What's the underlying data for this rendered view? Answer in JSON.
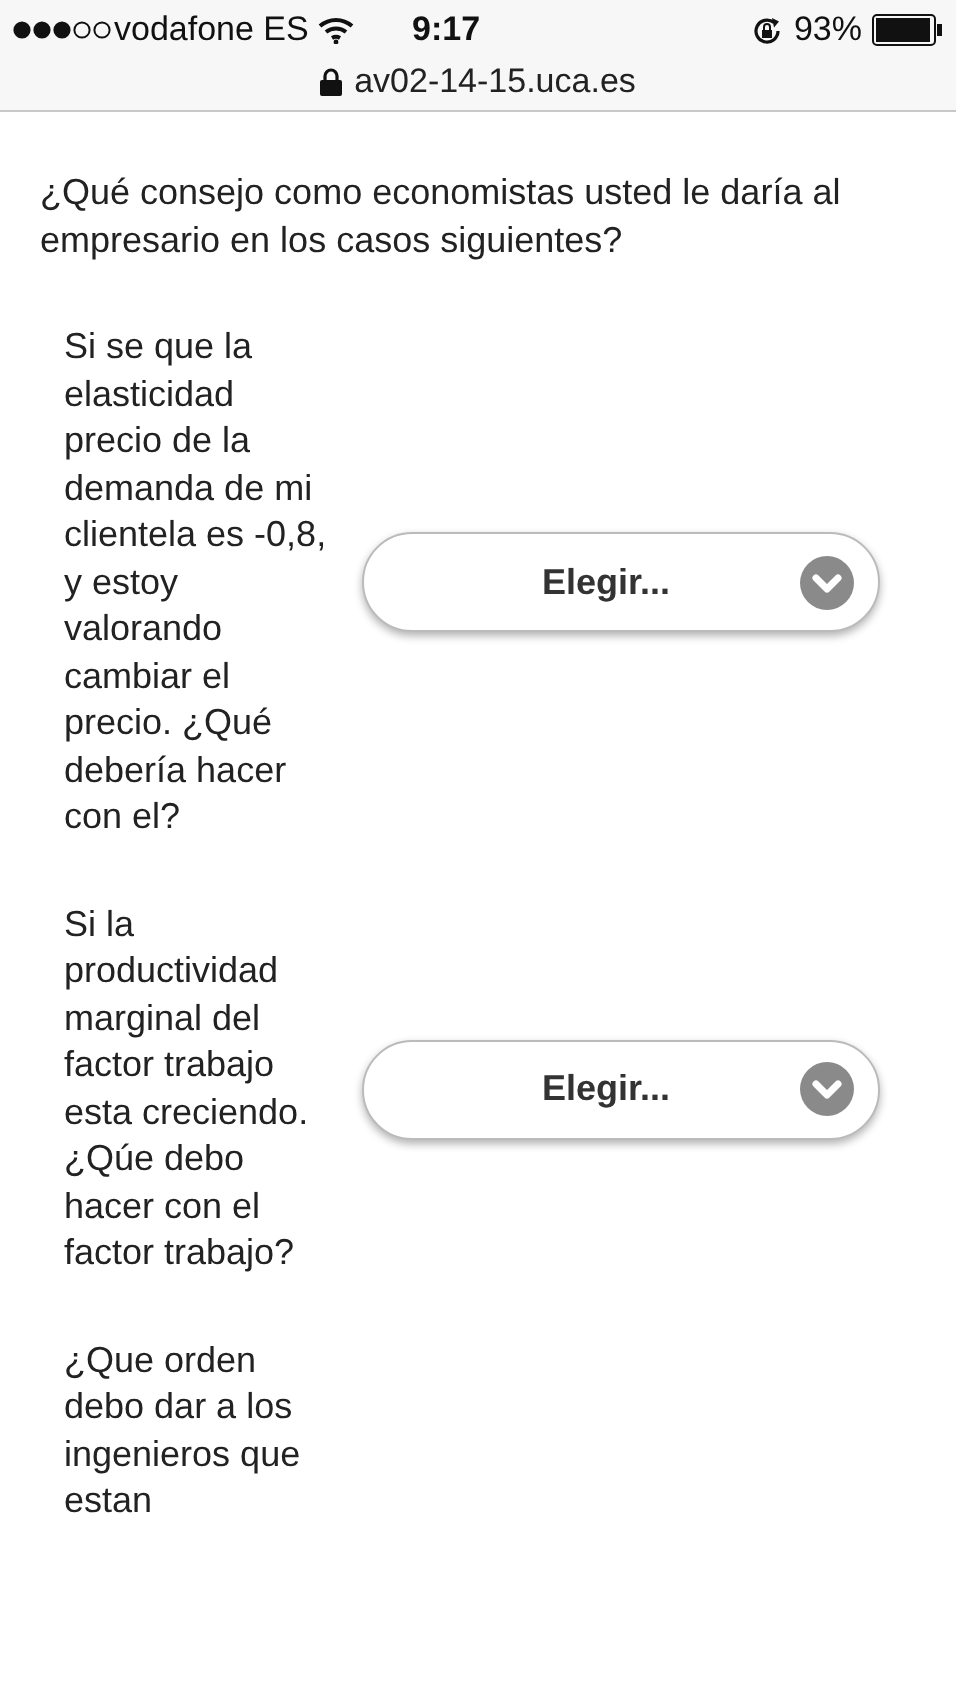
{
  "status_bar": {
    "carrier": "vodafone ES",
    "time": "9:17",
    "battery": "93%"
  },
  "address_bar": {
    "url": "av02-14-15.uca.es"
  },
  "intro": "¿Qué consejo como economistas usted le daría al empresario en los casos siguientes?",
  "questions": [
    {
      "text": "Si se que la elasticidad precio de la demanda de mi clientela es -0,8, y estoy valorando cambiar el precio. ¿Qué debería hacer con el?",
      "select": "Elegir..."
    },
    {
      "text": "Si la productividad marginal del factor trabajo esta creciendo. ¿Qúe debo hacer con el factor trabajo?",
      "select": "Elegir..."
    },
    {
      "text": "¿Que orden debo dar a los ingenieros que estan"
    }
  ]
}
